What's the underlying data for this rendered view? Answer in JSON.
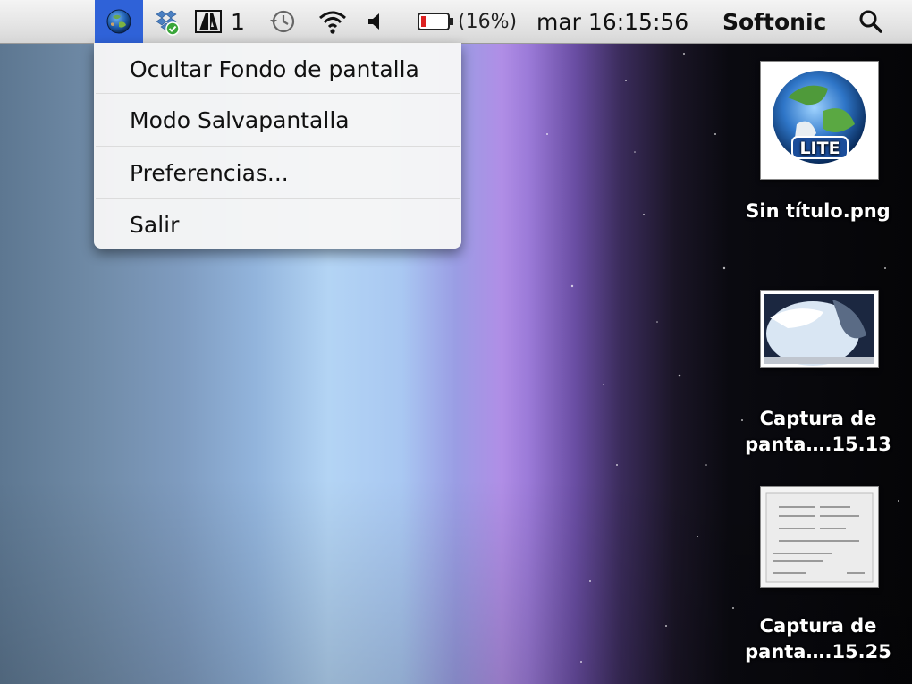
{
  "menubar": {
    "active_icon": "earth-globe-icon",
    "status_icons": [
      "dropbox-icon",
      "adobe-icon",
      "time-machine-icon",
      "wifi-icon",
      "volume-icon",
      "battery-icon",
      "spotlight-search-icon"
    ],
    "adobe_count": "1",
    "battery_text": "(16%)",
    "clock": "mar 16:15:56",
    "user": "Softonic",
    "active_color": "#2f62d8"
  },
  "menu": {
    "items": [
      {
        "label": "Ocultar Fondo de pantalla"
      },
      {
        "label": "Modo Salvapantalla"
      },
      {
        "label": "Preferencias..."
      },
      {
        "label": "Salir"
      }
    ]
  },
  "desktop": {
    "icons": [
      {
        "label": "Sin título.png",
        "thumb_text": "LITE"
      },
      {
        "label_line1": "Captura de",
        "label_line2": "panta….15.13"
      },
      {
        "label_line1": "Captura de",
        "label_line2": "panta….15.25"
      }
    ]
  }
}
